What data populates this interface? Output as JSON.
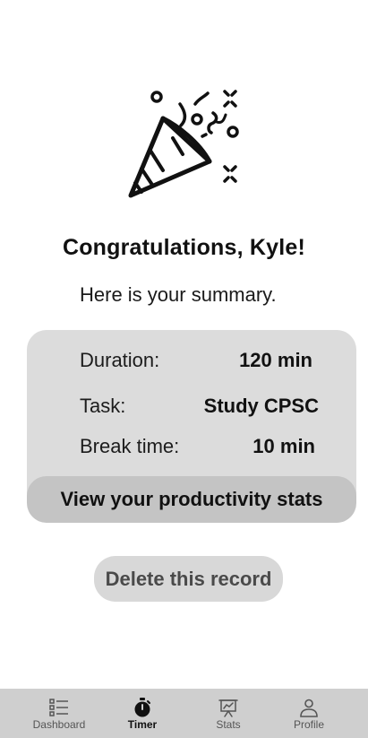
{
  "summary": {
    "title": "Congratulations, Kyle!",
    "subtitle": "Here is your summary.",
    "rows": [
      {
        "label": "Duration:",
        "value": "120 min"
      },
      {
        "label": "Task:",
        "value": "Study CPSC"
      },
      {
        "label": "Break time:",
        "value": "10 min"
      }
    ],
    "stats_button": "View your productivity stats",
    "delete_button": "Delete this record"
  },
  "icons": {
    "hero": "party-popper-icon",
    "dashboard": "list-icon",
    "timer": "stopwatch-icon",
    "stats": "presentation-chart-icon",
    "profile": "person-icon"
  },
  "tabbar": {
    "active": "Timer",
    "items": [
      {
        "label": "Dashboard"
      },
      {
        "label": "Timer"
      },
      {
        "label": "Stats"
      },
      {
        "label": "Profile"
      }
    ]
  },
  "colors": {
    "card": "#dcdcdc",
    "stats_button": "#c4c4c4",
    "delete_button": "#d8d8d8",
    "tabbar": "#cfcfcf"
  }
}
